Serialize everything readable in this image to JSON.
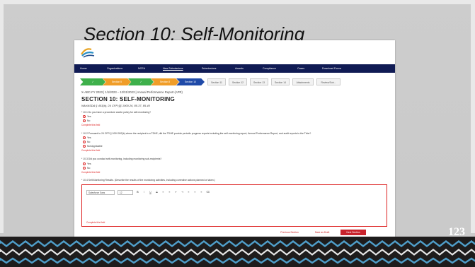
{
  "slide": {
    "title": "Section 10:  Self-Monitoring",
    "number": "123"
  },
  "screenshot": {
    "nav": [
      "Home",
      "Organizations",
      "NCEA",
      "New Submissions",
      "Submissions",
      "Awards",
      "Compliance",
      "Cases",
      "Download Forms"
    ],
    "active_nav": "New Submissions",
    "steps": [
      {
        "label": "✓",
        "state": "done"
      },
      {
        "label": "Section 5",
        "state": "current"
      },
      {
        "label": "✓",
        "state": "done"
      },
      {
        "label": "Section 8",
        "state": "current"
      },
      {
        "label": "Section 10",
        "state": "active"
      },
      {
        "label": "Section 11",
        "state": "plain"
      },
      {
        "label": "Section 12",
        "state": "plain"
      },
      {
        "label": "Section 13",
        "state": "plain"
      },
      {
        "label": "Section 14",
        "state": "plain"
      },
      {
        "label": "Attachments",
        "state": "plain"
      },
      {
        "label": "Review/Sub...",
        "state": "plain"
      }
    ],
    "report_title": "X-ABC-FY 2023 | 1/1/2023 – 12/31/2023 | Annual Performance Report (APR)",
    "section_heading": "SECTION 10: SELF-MONITORING",
    "citation": "NAHASDA § 403(b); 24 CFR §§ 1000.26, 85.37, 85.40",
    "q1": {
      "text": "* 10.1 Do you have a procedure and/or policy for self-monitoring?",
      "options": [
        "Yes",
        "No"
      ],
      "error": "Complete this field"
    },
    "q2": {
      "text": "* 10.2 Pursuant to 24 CFR § 1000.502(b) where the recipient is a TDHE, did the TDHE provide periodic progress reports including the self-monitoring report, Annual Performance Report, and audit reports to the Tribe?",
      "options": [
        "Yes",
        "No",
        "Not Applicable"
      ],
      "error": "Complete this field"
    },
    "q3": {
      "text": "* 10.3 Did you conduct self-monitoring, including monitoring sub-recipients?",
      "options": [
        "Yes",
        "No"
      ],
      "error": "Complete this field"
    },
    "q4": {
      "text": "* 10.4 Self-Monitoring Results. (Describe the results of the monitoring activities, including corrective actions planned or taken.)"
    },
    "editor": {
      "font": "Salesforce Sans",
      "size": "12",
      "toolbar_buttons": [
        "B",
        "I",
        "U",
        "S",
        "≡",
        "≡",
        "⇤",
        "⇥",
        "≡",
        "≡",
        "≡",
        "⌫"
      ],
      "error": "Complete this field"
    },
    "buttons": {
      "previous": "Previous Section",
      "save": "Save as Draft",
      "next": "Next Section"
    }
  }
}
